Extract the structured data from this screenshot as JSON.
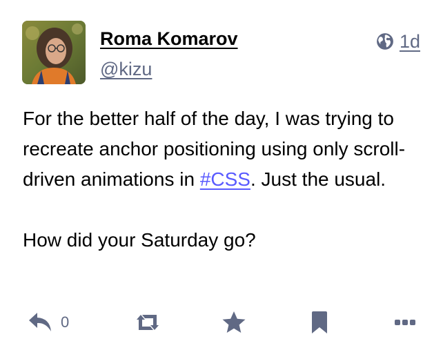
{
  "post": {
    "author": {
      "display_name": "Roma Komarov",
      "handle": "@kizu",
      "avatar_icon": "avatar-photo"
    },
    "visibility_icon": "globe-icon",
    "timestamp": "1d",
    "content": {
      "paragraph1_before": "For the better half of the day, I was trying to recreate anchor positioning using only scroll-driven animations in ",
      "hashtag": "#CSS",
      "paragraph1_after": ". Just the usual.",
      "paragraph2": "How did your Saturday go?"
    },
    "actions": {
      "reply_icon": "reply-icon",
      "reply_count": "0",
      "boost_icon": "boost-icon",
      "favourite_icon": "star-icon",
      "bookmark_icon": "bookmark-icon",
      "more_icon": "more-icon"
    }
  },
  "colors": {
    "text": "#000000",
    "muted": "#606984",
    "link": "#595aff"
  }
}
